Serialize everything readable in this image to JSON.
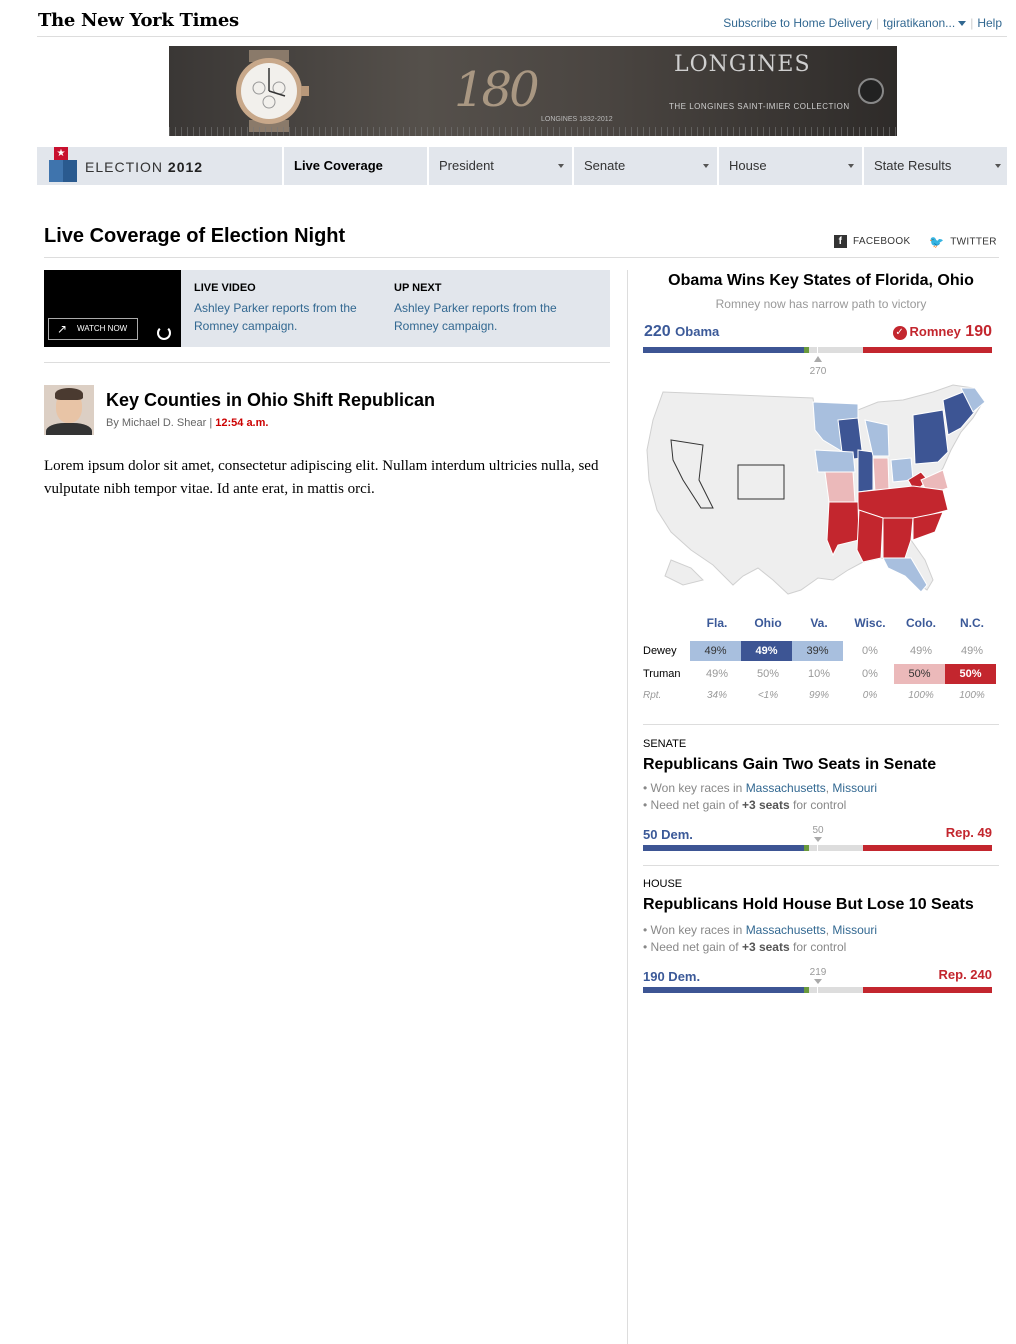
{
  "masthead": {
    "logo": "The New York Times",
    "subscribe": "Subscribe to Home Delivery",
    "user": "tgiratikanon...",
    "help": "Help"
  },
  "ad": {
    "number": "180",
    "brand": "LONGINES",
    "tagline": "THE LONGINES SAINT-IMIER COLLECTION",
    "years": "LONGINES 1832-2012"
  },
  "election_nav": {
    "label_light": "ELECTION",
    "label_bold": "2012",
    "items": [
      {
        "label": "Live Coverage",
        "active": true
      },
      {
        "label": "President"
      },
      {
        "label": "Senate"
      },
      {
        "label": "House"
      },
      {
        "label": "State Results"
      }
    ]
  },
  "headline": "Live Coverage of Election Night",
  "share": {
    "facebook": "FACEBOOK",
    "twitter": "TWITTER"
  },
  "video": {
    "watch_now": "WATCH NOW",
    "live_label": "LIVE VIDEO",
    "live_text": "Ashley Parker reports from the Romney campaign.",
    "next_label": "UP NEXT",
    "next_text": "Ashley Parker reports from the Romney campaign."
  },
  "article": {
    "title": "Key Counties in Ohio Shift Republican",
    "byline": "By Michael D. Shear",
    "time": "12:54 a.m.",
    "body": "Lorem ipsum dolor sit amet, consectetur adipiscing elit. Nullam interdum ultricies nulla, sed vulputate nibh tempor vitae. Id ante erat, in mattis orci."
  },
  "president": {
    "title": "Obama Wins Key States of Florida, Ohio",
    "subtitle": "Romney now has narrow path to victory",
    "dem_votes": "220",
    "dem_name": "Obama",
    "rep_name": "Romney",
    "rep_votes": "190",
    "threshold": "270",
    "dem_fraction": 0.46,
    "rep_fraction": 0.37
  },
  "states": {
    "headers": [
      "Fla.",
      "Ohio",
      "Va.",
      "Wisc.",
      "Colo.",
      "N.C."
    ],
    "rows": [
      {
        "name": "Dewey",
        "values": [
          "49%",
          "49%",
          "39%",
          "0%",
          "49%",
          "49%"
        ]
      },
      {
        "name": "Truman",
        "values": [
          "49%",
          "50%",
          "10%",
          "0%",
          "50%",
          "50%"
        ]
      }
    ],
    "rpt_label": "Rpt.",
    "rpt": [
      "34%",
      "<1%",
      "99%",
      "0%",
      "100%",
      "100%"
    ]
  },
  "senate": {
    "label": "SENATE",
    "title": "Republicans Gain Two Seats in Senate",
    "bullet1_pre": "• Won key races in ",
    "bullet1_link1": "Massachusetts",
    "bullet1_sep": ", ",
    "bullet1_link2": "Missouri",
    "bullet2_pre": "• Need net gain of ",
    "bullet2_bold": "+3 seats",
    "bullet2_post": " for control",
    "dem": "50 Dem.",
    "rep": "Rep. 49",
    "threshold": "50"
  },
  "house": {
    "label": "HOUSE",
    "title": "Republicans Hold House But Lose 10 Seats",
    "bullet1_pre": "• Won key races in ",
    "bullet1_link1": "Massachusetts",
    "bullet1_sep": ", ",
    "bullet1_link2": "Missouri",
    "bullet2_pre": "• Need net gain of ",
    "bullet2_bold": "+3 seats",
    "bullet2_post": " for control",
    "dem": "190 Dem.",
    "rep": "Rep. 240",
    "threshold": "219"
  },
  "colors": {
    "dem": "#3d5594",
    "dem_light": "#a8bfde",
    "rep": "#c3262e",
    "rep_light": "#ebb9ba",
    "link": "#326891"
  }
}
